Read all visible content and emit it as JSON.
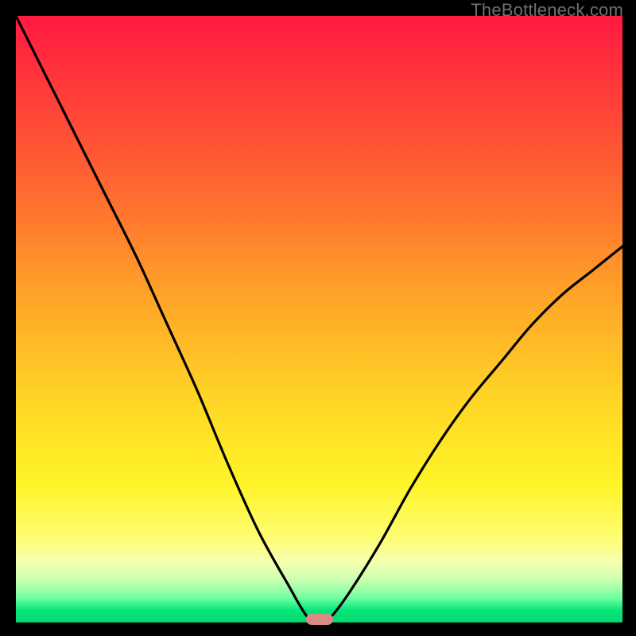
{
  "attribution": "TheBottleneck.com",
  "colors": {
    "background": "#000000",
    "gradient_top": "#ff1940",
    "gradient_mid": "#ffd226",
    "gradient_bottom": "#05d873",
    "curve": "#000000",
    "marker": "#d98b84"
  },
  "chart_data": {
    "type": "line",
    "title": "",
    "xlabel": "",
    "ylabel": "",
    "xlim": [
      0,
      100
    ],
    "ylim": [
      0,
      100
    ],
    "x": [
      0,
      5,
      10,
      15,
      20,
      25,
      30,
      35,
      40,
      45,
      48,
      50,
      52,
      55,
      60,
      65,
      70,
      75,
      80,
      85,
      90,
      95,
      100
    ],
    "values": [
      100,
      90,
      80,
      70,
      60,
      49,
      38,
      26,
      15,
      6,
      1,
      0,
      1,
      5,
      13,
      22,
      30,
      37,
      43,
      49,
      54,
      58,
      62
    ],
    "marker": {
      "x": 50,
      "y": 0
    },
    "notes": "V-shaped bottleneck curve; y is mismatch percentage (0 = optimal, green zone). Minimum near x≈50. No axis ticks or numeric labels visible."
  }
}
